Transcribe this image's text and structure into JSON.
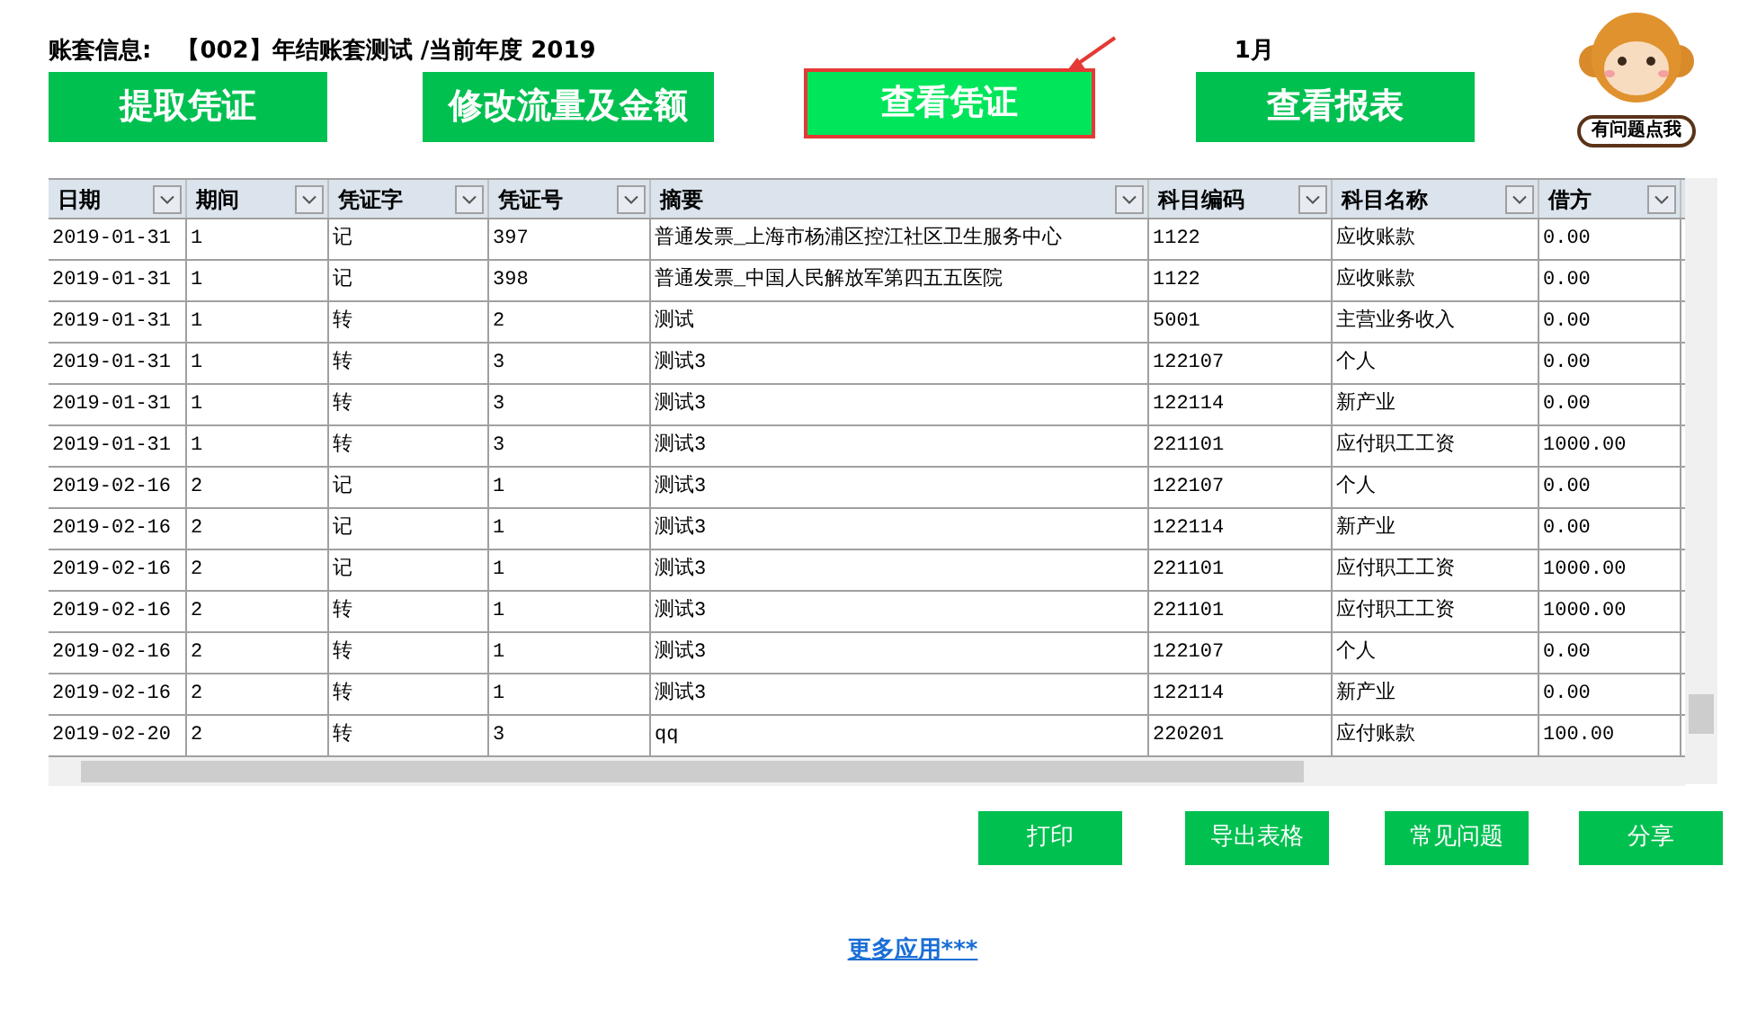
{
  "header": {
    "label": "账套信息:",
    "account": "【002】年结账套测试 /当前年度 2019",
    "month": "1月"
  },
  "helper": {
    "label": "有问题点我"
  },
  "actions": [
    {
      "label": "提取凭证",
      "selected": false
    },
    {
      "label": "修改流量及金额",
      "selected": false
    },
    {
      "label": "查看凭证",
      "selected": true
    },
    {
      "label": "查看报表",
      "selected": false
    }
  ],
  "table": {
    "columns": [
      "日期",
      "期间",
      "凭证字",
      "凭证号",
      "摘要",
      "科目编码",
      "科目名称",
      "借方"
    ],
    "rows": [
      [
        "2019-01-31",
        "1",
        "记",
        "397",
        "普通发票_上海市杨浦区控江社区卫生服务中心",
        "1122",
        "应收账款",
        "0.00"
      ],
      [
        "2019-01-31",
        "1",
        "记",
        "398",
        "普通发票_中国人民解放军第四五五医院",
        "1122",
        "应收账款",
        "0.00"
      ],
      [
        "2019-01-31",
        "1",
        "转",
        "2",
        "测试",
        "5001",
        "主营业务收入",
        "0.00"
      ],
      [
        "2019-01-31",
        "1",
        "转",
        "3",
        "测试3",
        "122107",
        "个人",
        "0.00"
      ],
      [
        "2019-01-31",
        "1",
        "转",
        "3",
        "测试3",
        "122114",
        "新产业",
        "0.00"
      ],
      [
        "2019-01-31",
        "1",
        "转",
        "3",
        "测试3",
        "221101",
        "应付职工工资",
        "1000.00"
      ],
      [
        "2019-02-16",
        "2",
        "记",
        "1",
        "测试3",
        "122107",
        "个人",
        "0.00"
      ],
      [
        "2019-02-16",
        "2",
        "记",
        "1",
        "测试3",
        "122114",
        "新产业",
        "0.00"
      ],
      [
        "2019-02-16",
        "2",
        "记",
        "1",
        "测试3",
        "221101",
        "应付职工工资",
        "1000.00"
      ],
      [
        "2019-02-16",
        "2",
        "转",
        "1",
        "测试3",
        "221101",
        "应付职工工资",
        "1000.00"
      ],
      [
        "2019-02-16",
        "2",
        "转",
        "1",
        "测试3",
        "122107",
        "个人",
        "0.00"
      ],
      [
        "2019-02-16",
        "2",
        "转",
        "1",
        "测试3",
        "122114",
        "新产业",
        "0.00"
      ],
      [
        "2019-02-20",
        "2",
        "转",
        "3",
        "qq",
        "220201",
        "应付账款",
        "100.00"
      ]
    ]
  },
  "footer_buttons": [
    "打印",
    "导出表格",
    "常见问题",
    "分享"
  ],
  "link": "更多应用***"
}
